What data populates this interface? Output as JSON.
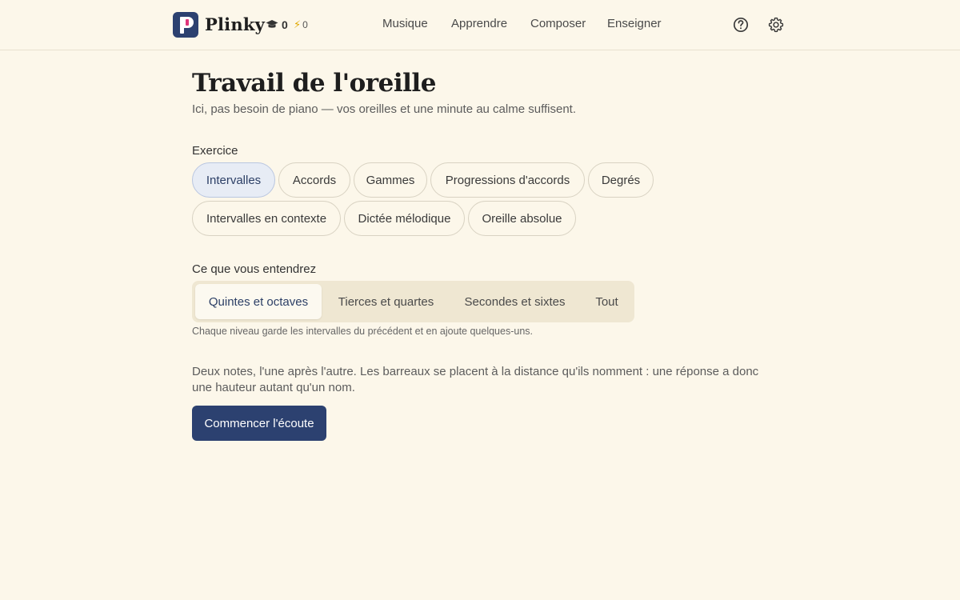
{
  "header": {
    "app_name": "Plinky",
    "stats": {
      "graduation_count": "0",
      "energy_count": "0"
    },
    "nav": [
      "Musique",
      "Apprendre",
      "Composer",
      "Enseigner"
    ],
    "icons": {
      "help": "help-circle-icon",
      "settings": "gear-icon",
      "graduation": "graduation-cap-icon",
      "energy": "lightning-icon"
    }
  },
  "main": {
    "title": "Travail de l'oreille",
    "subtitle": "Ici, pas besoin de piano — vos oreilles et une minute au calme suffisent.",
    "exercise": {
      "label": "Exercice",
      "options": [
        "Intervalles",
        "Accords",
        "Gammes",
        "Progressions d'accords",
        "Degrés",
        "Intervalles en contexte",
        "Dictée mélodique",
        "Oreille absolue"
      ],
      "selected": "Intervalles"
    },
    "level": {
      "label": "Ce que vous entendrez",
      "options": [
        "Quintes et octaves",
        "Tierces et quartes",
        "Secondes et sixtes",
        "Tout"
      ],
      "selected": "Quintes et octaves",
      "hint": "Chaque niveau garde les intervalles du précédent et en ajoute quelques-uns."
    },
    "description": "Deux notes, l'une après l'autre. Les barreaux se placent à la distance qu'ils nomment : une réponse a donc une hauteur autant qu'un nom.",
    "start_button": "Commencer l'écoute"
  },
  "colors": {
    "background": "#fcf7ea",
    "accent": "#2c4170",
    "logo_pink": "#e0357b"
  }
}
